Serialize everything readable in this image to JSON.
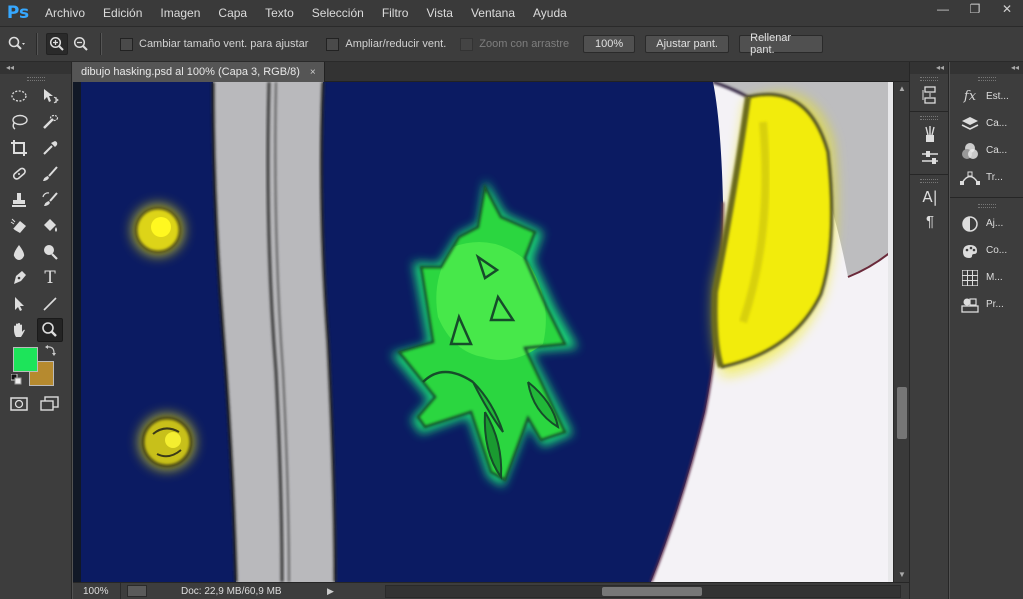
{
  "app": {
    "logo": "Ps"
  },
  "menu": [
    "Archivo",
    "Edición",
    "Imagen",
    "Capa",
    "Texto",
    "Selección",
    "Filtro",
    "Vista",
    "Ventana",
    "Ayuda"
  ],
  "window_controls": {
    "minimize": "—",
    "restore": "❐",
    "close": "✕"
  },
  "options": {
    "resize_windows": "Cambiar tamaño vent. para ajustar",
    "zoom_all_windows": "Ampliar/reducir vent.",
    "scrubby_zoom": "Zoom con arrastre",
    "zoom_100": "100%",
    "fit_screen": "Ajustar pant.",
    "fill_screen": "Rellenar pant."
  },
  "colors": {
    "foreground": "#1de45a",
    "background": "#b68a2f",
    "ps_blue": "#36a8ff"
  },
  "document": {
    "tab_title": "dibujo hasking.psd al 100% (Capa 3, RGB/8)",
    "close_glyph": "×"
  },
  "status": {
    "zoom": "100%",
    "doc_info": "Doc: 22,9 MB/60,9 MB",
    "arrow": "▶"
  },
  "panel_right": [
    {
      "icon": "fx-styles-icon",
      "label": "Est..."
    },
    {
      "icon": "layers-icon",
      "label": "Ca..."
    },
    {
      "icon": "channels-icon",
      "label": "Ca..."
    },
    {
      "icon": "paths-icon",
      "label": "Tr..."
    },
    {
      "icon": "adjustments-icon",
      "label": "Aj..."
    },
    {
      "icon": "color-icon",
      "label": "Co..."
    },
    {
      "icon": "swatches-icon",
      "label": "M..."
    },
    {
      "icon": "presets-icon",
      "label": "Pr..."
    }
  ],
  "collapse_glyph": "◂◂"
}
